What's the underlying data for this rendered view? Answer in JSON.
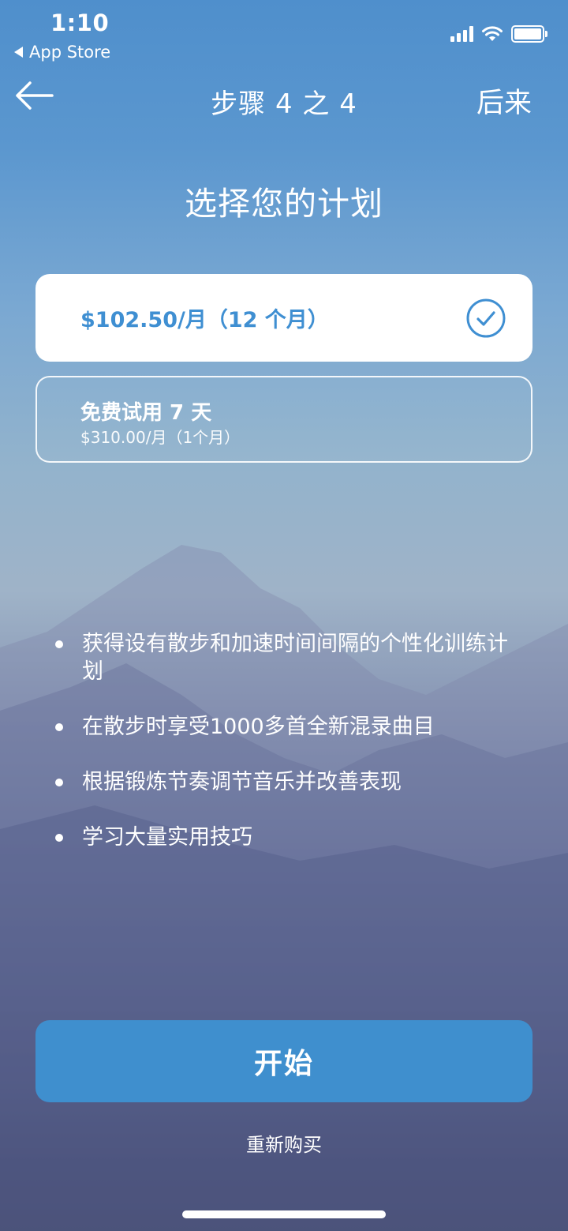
{
  "status_bar": {
    "time": "1:10",
    "back_app": "App Store",
    "icons": [
      "signal-icon",
      "wifi-icon",
      "battery-icon"
    ]
  },
  "nav": {
    "back_icon": "arrow-left-icon",
    "title": "步骤 4 之 4",
    "later": "后来"
  },
  "page_title": "选择您的计划",
  "plans": [
    {
      "price": "$102.50/月（12 个月）",
      "selected": true,
      "check_icon": "check-circle-icon"
    },
    {
      "title": "免费试用 7 天",
      "subtitle": "$310.00/月（1个月）",
      "selected": false
    }
  ],
  "features": [
    "获得设有散步和加速时间间隔的个性化训练计划",
    "在散步时享受1000多首全新混录曲目",
    "根据锻炼节奏调节音乐并改善表现",
    "学习大量实用技巧"
  ],
  "start_button": "开始",
  "restore_link": "重新购买",
  "colors": {
    "accent": "#3f8fce",
    "selected_price": "#3f8fd2",
    "card_bg": "#ffffff"
  }
}
